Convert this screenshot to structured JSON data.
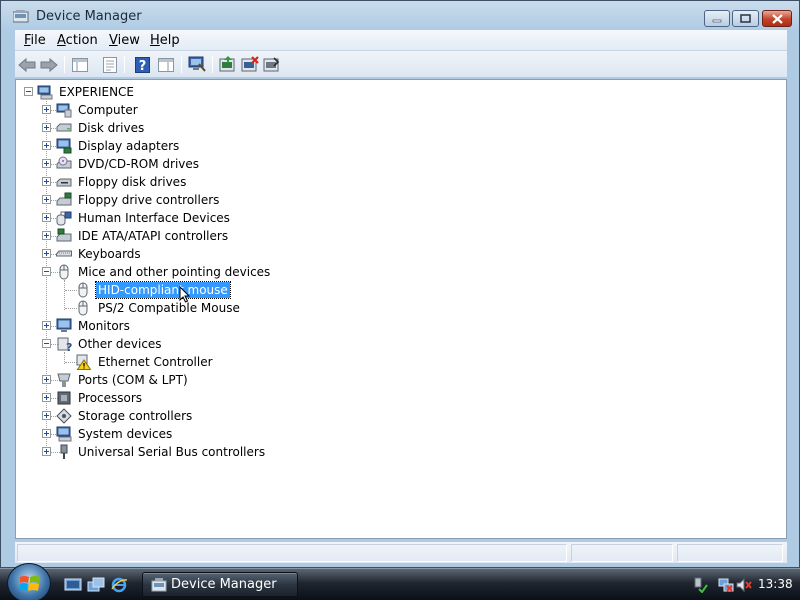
{
  "window": {
    "title": "Device Manager",
    "title_icon": "device-manager-icon",
    "controls": [
      "minimize-icon",
      "maximize-icon",
      "close-icon"
    ]
  },
  "menubar": {
    "items": [
      {
        "label": "File",
        "accel": "F",
        "rest": "ile"
      },
      {
        "label": "Action",
        "accel": "A",
        "rest": "ction"
      },
      {
        "label": "View",
        "accel": "V",
        "rest": "iew"
      },
      {
        "label": "Help",
        "accel": "H",
        "rest": "elp"
      }
    ]
  },
  "toolbar": {
    "buttons": [
      "back-icon",
      "forward-icon",
      "show-hide-console-tree-icon",
      "properties-icon",
      "help-icon",
      "show-action-pane-icon",
      "scan-hardware-icon",
      "update-driver-icon",
      "uninstall-icon",
      "disable-icon"
    ]
  },
  "tree": {
    "root": {
      "label": "EXPERIENCE",
      "icon": "computer-icon",
      "expanded": true
    },
    "categories": [
      {
        "label": "Computer",
        "icon": "computer-icon",
        "expanded": false
      },
      {
        "label": "Disk drives",
        "icon": "disk-drive-icon",
        "expanded": false
      },
      {
        "label": "Display adapters",
        "icon": "display-adapter-icon",
        "expanded": false
      },
      {
        "label": "DVD/CD-ROM drives",
        "icon": "cdrom-icon",
        "expanded": false
      },
      {
        "label": "Floppy disk drives",
        "icon": "floppy-drive-icon",
        "expanded": false
      },
      {
        "label": "Floppy drive controllers",
        "icon": "floppy-controller-icon",
        "expanded": false
      },
      {
        "label": "Human Interface Devices",
        "icon": "hid-icon",
        "expanded": false
      },
      {
        "label": "IDE ATA/ATAPI controllers",
        "icon": "ide-controller-icon",
        "expanded": false
      },
      {
        "label": "Keyboards",
        "icon": "keyboard-icon",
        "expanded": false
      },
      {
        "label": "Mice and other pointing devices",
        "icon": "mouse-icon",
        "expanded": true,
        "children": [
          {
            "label": "HID-compliant mouse",
            "icon": "mouse-icon",
            "selected": true
          },
          {
            "label": "PS/2 Compatible Mouse",
            "icon": "mouse-icon",
            "selected": false
          }
        ]
      },
      {
        "label": "Monitors",
        "icon": "monitor-icon",
        "expanded": false
      },
      {
        "label": "Other devices",
        "icon": "unknown-device-icon",
        "expanded": true,
        "children": [
          {
            "label": "Ethernet Controller",
            "icon": "warning-device-icon",
            "selected": false
          }
        ]
      },
      {
        "label": "Ports (COM & LPT)",
        "icon": "port-icon",
        "expanded": false
      },
      {
        "label": "Processors",
        "icon": "processor-icon",
        "expanded": false
      },
      {
        "label": "Storage controllers",
        "icon": "storage-controller-icon",
        "expanded": false
      },
      {
        "label": "System devices",
        "icon": "system-device-icon",
        "expanded": false
      },
      {
        "label": "Universal Serial Bus controllers",
        "icon": "usb-icon",
        "expanded": false
      }
    ]
  },
  "taskbar": {
    "start_icon": "windows-start-icon",
    "quick_launch": [
      "show-desktop-icon",
      "switch-windows-icon",
      "internet-explorer-icon"
    ],
    "task_button": {
      "label": "Device Manager",
      "icon": "device-manager-icon"
    },
    "tray": {
      "icons": [
        "safely-remove-hardware-icon",
        "network-disconnected-icon",
        "volume-muted-icon"
      ],
      "clock": "13:38"
    }
  },
  "colors": {
    "selection": "#3399ff",
    "close_button": "#c2432a",
    "frame": "#aecbe3"
  }
}
